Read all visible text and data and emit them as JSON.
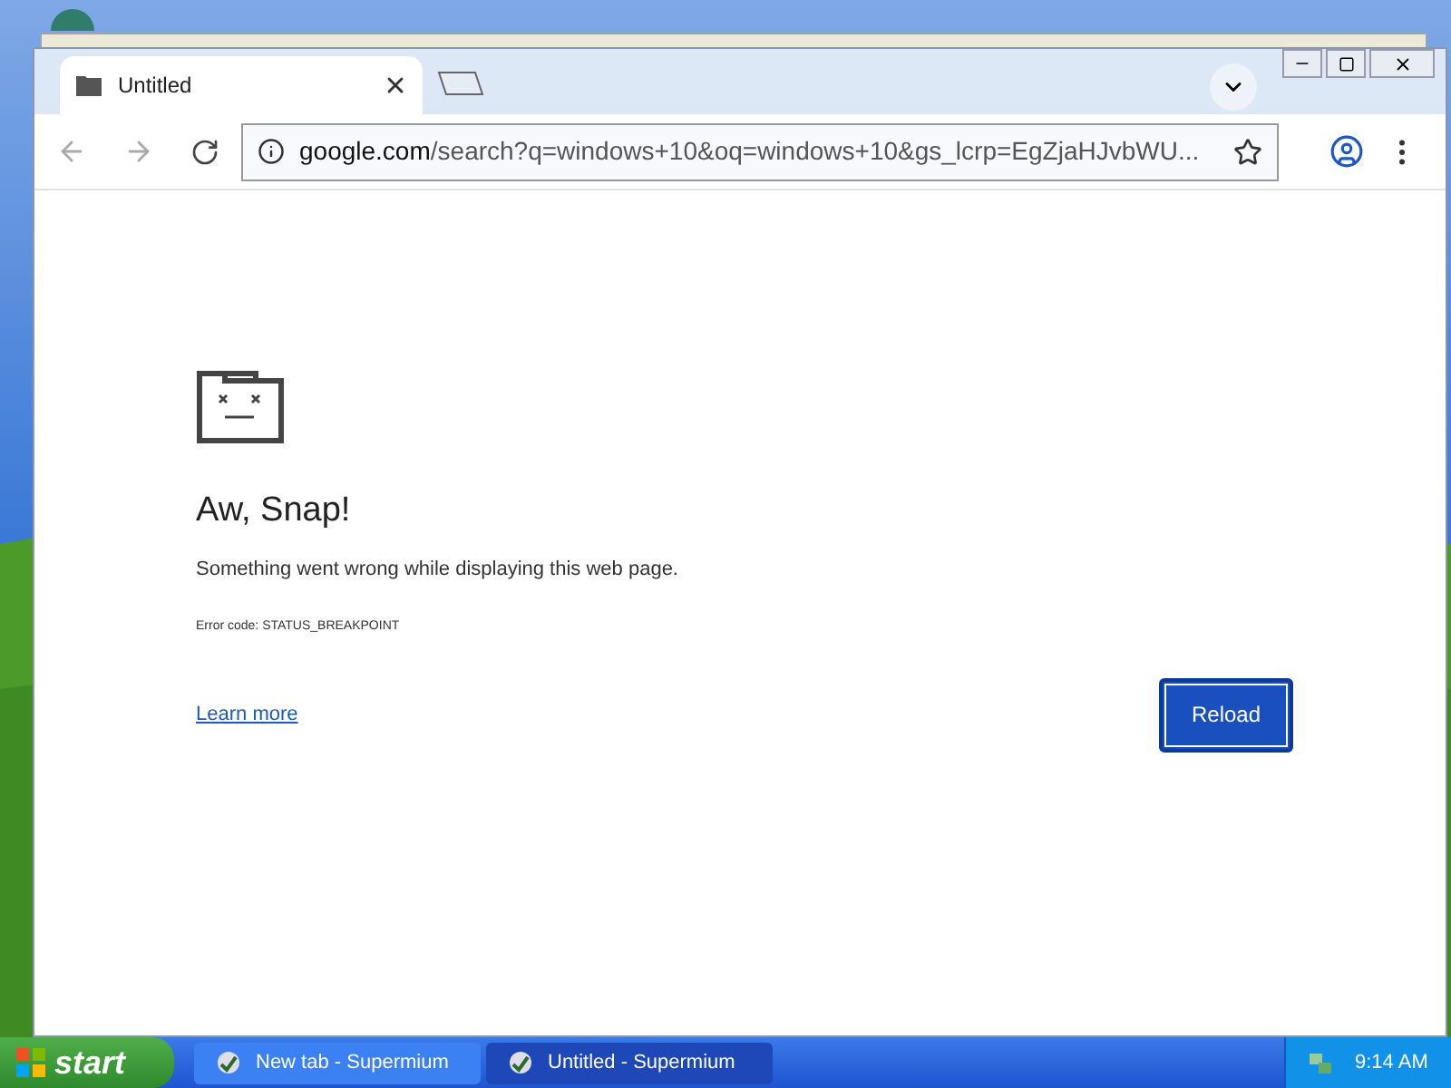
{
  "browser": {
    "tabs": [
      {
        "title": "Untitled",
        "selected": true
      }
    ],
    "address_host": "google.com",
    "address_path": "/search?q=windows+10&oq=windows+10&gs_lcrp=EgZjaHJvbWU...",
    "page": {
      "heading": "Aw, Snap!",
      "message": "Something went wrong while displaying this web page.",
      "error_code": "Error code: STATUS_BREAKPOINT",
      "link": "Learn more",
      "button": "Reload"
    }
  },
  "taskbar": {
    "start": "start",
    "buttons": [
      {
        "label": "New tab - Supermium",
        "selected": false
      },
      {
        "label": "Untitled - Supermium",
        "selected": true
      }
    ],
    "clock": "9:14 AM"
  }
}
